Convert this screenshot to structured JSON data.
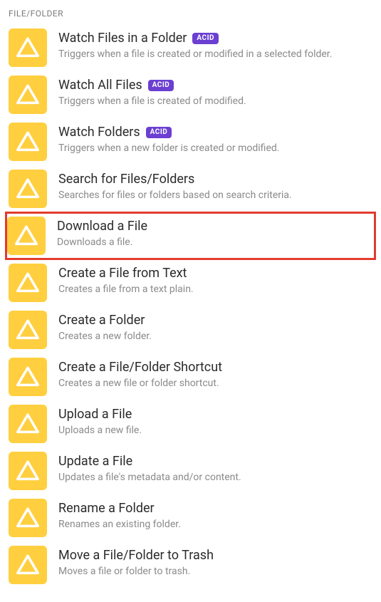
{
  "section_header": "FILE/FOLDER",
  "badge_label": "ACID",
  "items": [
    {
      "title": "Watch Files in a Folder",
      "desc": "Triggers when a file is created or modified in a selected folder.",
      "badge": true,
      "highlighted": false
    },
    {
      "title": "Watch All Files",
      "desc": "Triggers when a file is created of modified.",
      "badge": true,
      "highlighted": false
    },
    {
      "title": "Watch Folders",
      "desc": "Triggers when a new folder is created or modified.",
      "badge": true,
      "highlighted": false
    },
    {
      "title": "Search for Files/Folders",
      "desc": "Searches for files or folders based on search criteria.",
      "badge": false,
      "highlighted": false
    },
    {
      "title": "Download a File",
      "desc": "Downloads a file.",
      "badge": false,
      "highlighted": true
    },
    {
      "title": "Create a File from Text",
      "desc": "Creates a file from a text plain.",
      "badge": false,
      "highlighted": false
    },
    {
      "title": "Create a Folder",
      "desc": "Creates a new folder.",
      "badge": false,
      "highlighted": false
    },
    {
      "title": "Create a File/Folder Shortcut",
      "desc": "Creates a new file or folder shortcut.",
      "badge": false,
      "highlighted": false
    },
    {
      "title": "Upload a File",
      "desc": "Uploads a new file.",
      "badge": false,
      "highlighted": false
    },
    {
      "title": "Update a File",
      "desc": "Updates a file's metadata and/or content.",
      "badge": false,
      "highlighted": false
    },
    {
      "title": "Rename a Folder",
      "desc": "Renames an existing folder.",
      "badge": false,
      "highlighted": false
    },
    {
      "title": "Move a File/Folder to Trash",
      "desc": "Moves a file or folder to trash.",
      "badge": false,
      "highlighted": false
    }
  ]
}
